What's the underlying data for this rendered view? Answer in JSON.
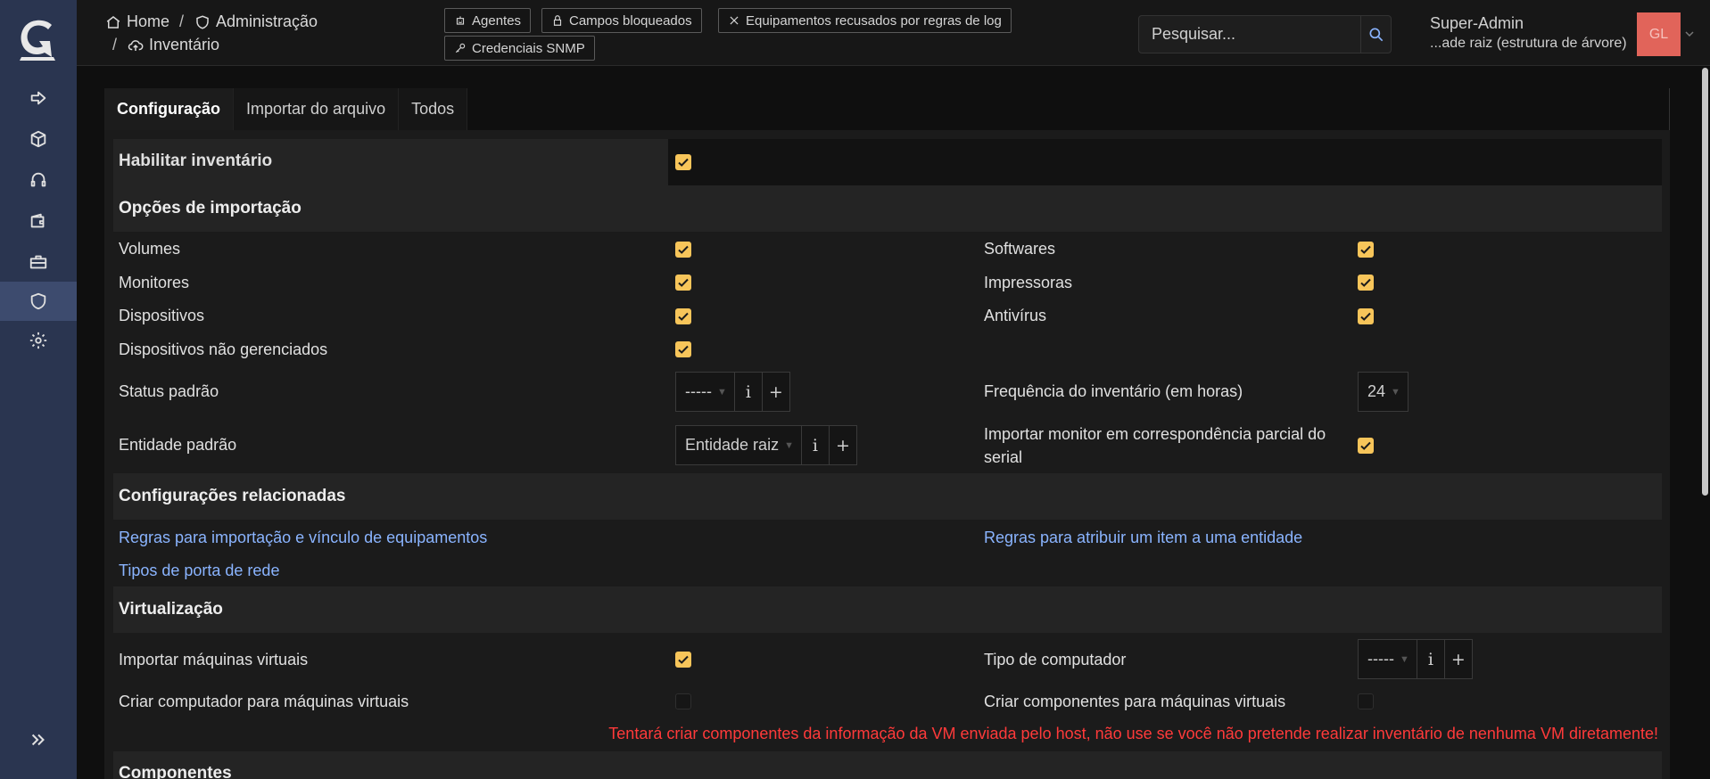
{
  "breadcrumb": {
    "home": "Home",
    "admin": "Administração",
    "inventory": "Inventário",
    "sep": "/"
  },
  "header_buttons": {
    "agents": "Agentes",
    "locked_fields": "Campos bloqueados",
    "refused": "Equipamentos recusados por regras de log",
    "snmp": "Credenciais SNMP"
  },
  "search": {
    "placeholder": "Pesquisar..."
  },
  "user": {
    "name": "Super-Admin",
    "entity": "...ade raiz (estrutura de árvore)",
    "initials": "GL",
    "avatar_color": "#e1645a"
  },
  "tabs": [
    "Configuração",
    "Importar do arquivo",
    "Todos"
  ],
  "config": {
    "enable_label": "Habilitar inventário",
    "import_section": "Opções de importação",
    "volumes": "Volumes",
    "softwares": "Softwares",
    "monitors": "Monitores",
    "printers": "Impressoras",
    "devices": "Dispositivos",
    "antivirus": "Antivírus",
    "unmanaged": "Dispositivos não gerenciados",
    "default_status": "Status padrão",
    "default_status_value": "-----",
    "frequency": "Frequência do inventário (em horas)",
    "frequency_value": "24",
    "default_entity": "Entidade padrão",
    "default_entity_value": "Entidade raiz",
    "partial_serial_1": "Importar monitor em correspondência parcial do",
    "partial_serial_2": "serial",
    "related_section": "Configurações relacionadas",
    "link_import_rules": "Regras para importação e vínculo de equipamentos",
    "link_entity_rules": "Regras para atribuir um item a uma entidade",
    "link_port_types": "Tipos de porta de rede",
    "virt_section": "Virtualização",
    "import_vms": "Importar máquinas virtuais",
    "computer_type": "Tipo de computador",
    "computer_type_value": "-----",
    "create_computer_vms": "Criar computador para máquinas virtuais",
    "create_components_vms": "Criar componentes para máquinas virtuais",
    "warning": "Tentará criar componentes da informação da VM enviada pelo host, não use se você não pretende realizar inventário de nenhuma VM diretamente!",
    "components_section": "Componentes",
    "info_btn": "i",
    "add_btn": "+"
  },
  "colors": {
    "accent_checkbox": "#f7c55a",
    "link": "#8ab4ff",
    "warning": "#ff3a3a",
    "sidebar": "#2a3550"
  }
}
